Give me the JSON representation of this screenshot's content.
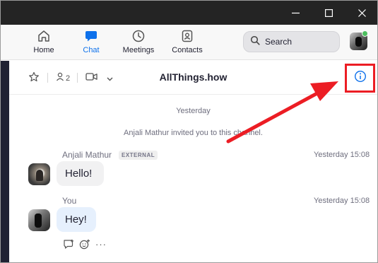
{
  "window": {
    "controls": {
      "minimize_icon": "minimize-icon",
      "maximize_icon": "maximize-icon",
      "close_icon": "close-icon"
    }
  },
  "topnav": {
    "items": [
      {
        "label": "Home",
        "icon": "home-icon"
      },
      {
        "label": "Chat",
        "icon": "chat-bubble-icon",
        "active": true
      },
      {
        "label": "Meetings",
        "icon": "clock-icon"
      },
      {
        "label": "Contacts",
        "icon": "contacts-icon"
      }
    ],
    "search": {
      "label": "Search",
      "icon": "search-icon"
    },
    "presence": "online"
  },
  "channel": {
    "title": "AllThings.how",
    "member_count": "2",
    "icons": {
      "star": "star-icon",
      "members": "person-icon",
      "video": "video-camera-icon",
      "dropdown": "chevron-down-icon",
      "info": "info-icon"
    }
  },
  "messages": {
    "date_separator": "Yesterday",
    "system_message": "Anjali Mathur invited you to this channel.",
    "items": [
      {
        "sender": "Anjali Mathur",
        "badge": "EXTERNAL",
        "time": "Yesterday 15:08",
        "text": "Hello!"
      },
      {
        "sender": "You",
        "time": "Yesterday 15:08",
        "text": "Hey!"
      }
    ],
    "actions": {
      "reply_icon": "reply-icon",
      "emoji_icon": "add-emoji-icon",
      "more": "···"
    }
  },
  "colors": {
    "accent": "#0e71eb",
    "titlebar": "#242424",
    "annotation": "#ec1d24",
    "online": "#4cbf5f"
  }
}
